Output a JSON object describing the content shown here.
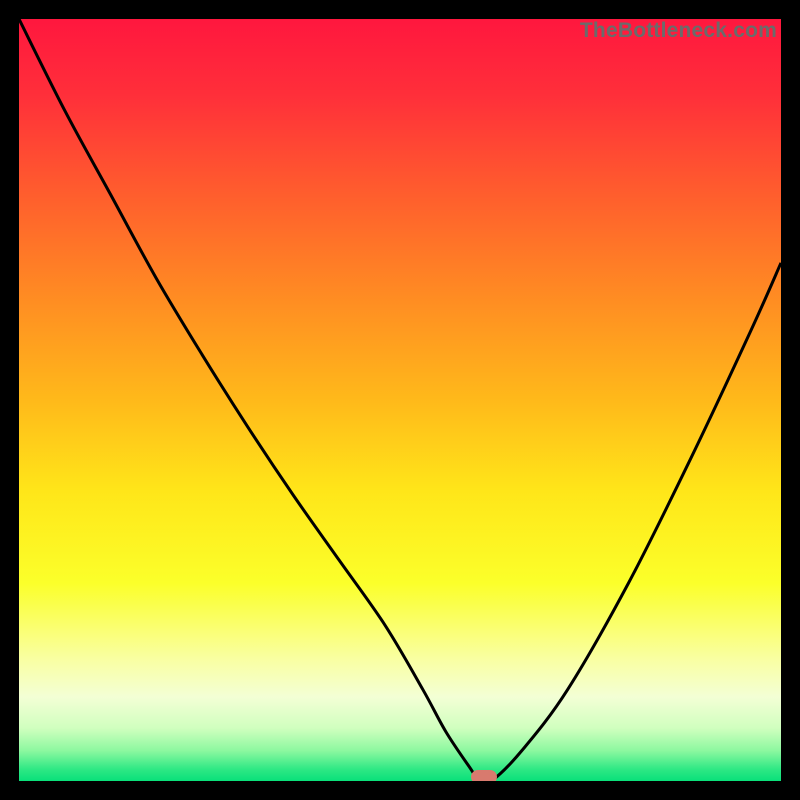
{
  "watermark": {
    "text": "TheBottleneck.com"
  },
  "colors": {
    "frame_border": "#000000",
    "curve_stroke": "#000000",
    "marker_fill": "#d87a6e",
    "gradient_stops": [
      {
        "offset": 0.0,
        "color": "#ff173e"
      },
      {
        "offset": 0.1,
        "color": "#ff2f3a"
      },
      {
        "offset": 0.22,
        "color": "#ff5a2e"
      },
      {
        "offset": 0.36,
        "color": "#ff8a23"
      },
      {
        "offset": 0.5,
        "color": "#ffb91a"
      },
      {
        "offset": 0.62,
        "color": "#ffe619"
      },
      {
        "offset": 0.74,
        "color": "#fbff2a"
      },
      {
        "offset": 0.84,
        "color": "#f9ffa2"
      },
      {
        "offset": 0.89,
        "color": "#f3ffd5"
      },
      {
        "offset": 0.93,
        "color": "#d1ffbf"
      },
      {
        "offset": 0.96,
        "color": "#8df8a0"
      },
      {
        "offset": 0.985,
        "color": "#2de884"
      },
      {
        "offset": 1.0,
        "color": "#09e07a"
      }
    ]
  },
  "chart_data": {
    "type": "line",
    "title": "",
    "xlabel": "",
    "ylabel": "",
    "xlim": [
      0,
      100
    ],
    "ylim": [
      0,
      100
    ],
    "series": [
      {
        "name": "bottleneck-curve",
        "x": [
          0,
          6,
          12,
          18,
          24,
          30,
          36,
          42,
          48,
          53,
          56,
          59,
          60.5,
          62,
          66,
          72,
          80,
          88,
          96,
          100
        ],
        "y": [
          100,
          88,
          77,
          66,
          56,
          46.5,
          37.5,
          29,
          20.5,
          12,
          6.5,
          2,
          0,
          0,
          4,
          12,
          26,
          42,
          59,
          68
        ]
      }
    ],
    "marker": {
      "x": 61,
      "y": 0
    },
    "annotations": []
  }
}
